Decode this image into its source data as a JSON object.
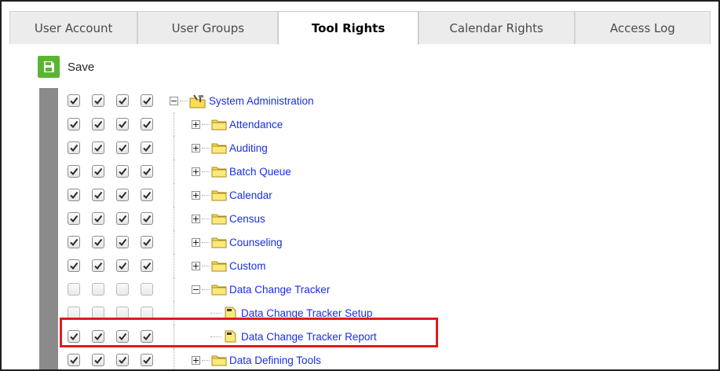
{
  "tabs": [
    {
      "label": "User Account"
    },
    {
      "label": "User Groups"
    },
    {
      "label": "Tool Rights",
      "active": true
    },
    {
      "label": "Calendar Rights"
    },
    {
      "label": "Access Log"
    }
  ],
  "toolbar": {
    "save_label": "Save",
    "save_icon": "floppy-disk-icon"
  },
  "colors": {
    "accent_green": "#5cb531",
    "link_blue": "#1a2ee6",
    "highlight_red": "#e3191e",
    "left_bar_gray": "#8a8a8a"
  },
  "tree": {
    "root": {
      "label": "System Administration",
      "icon": "tools-folder-icon",
      "expanded": true,
      "checks": [
        true,
        true,
        true,
        true
      ]
    },
    "items": [
      {
        "label": "Attendance",
        "icon": "folder-icon",
        "expanded": false,
        "checks": [
          true,
          true,
          true,
          true
        ]
      },
      {
        "label": "Auditing",
        "icon": "folder-icon",
        "expanded": false,
        "checks": [
          true,
          true,
          true,
          true
        ]
      },
      {
        "label": "Batch Queue",
        "icon": "folder-icon",
        "expanded": false,
        "checks": [
          true,
          true,
          true,
          true
        ]
      },
      {
        "label": "Calendar",
        "icon": "folder-icon",
        "expanded": false,
        "checks": [
          true,
          true,
          true,
          true
        ]
      },
      {
        "label": "Census",
        "icon": "folder-icon",
        "expanded": false,
        "checks": [
          true,
          true,
          true,
          true
        ]
      },
      {
        "label": "Counseling",
        "icon": "folder-icon",
        "expanded": false,
        "checks": [
          true,
          true,
          true,
          true
        ]
      },
      {
        "label": "Custom",
        "icon": "folder-icon",
        "expanded": false,
        "checks": [
          true,
          true,
          true,
          true
        ]
      },
      {
        "label": "Data Change Tracker",
        "icon": "folder-icon",
        "expanded": true,
        "checks": [
          false,
          false,
          false,
          false
        ],
        "children": [
          {
            "label": "Data Change Tracker Setup",
            "icon": "tool-page-icon",
            "checks": [
              false,
              false,
              false,
              false
            ]
          },
          {
            "label": "Data Change Tracker Report",
            "icon": "tool-page-icon",
            "checks": [
              true,
              true,
              true,
              true
            ],
            "highlighted": true
          }
        ]
      },
      {
        "label": "Data Defining Tools",
        "icon": "folder-icon",
        "expanded": false,
        "checks": [
          true,
          true,
          true,
          true
        ]
      }
    ]
  }
}
